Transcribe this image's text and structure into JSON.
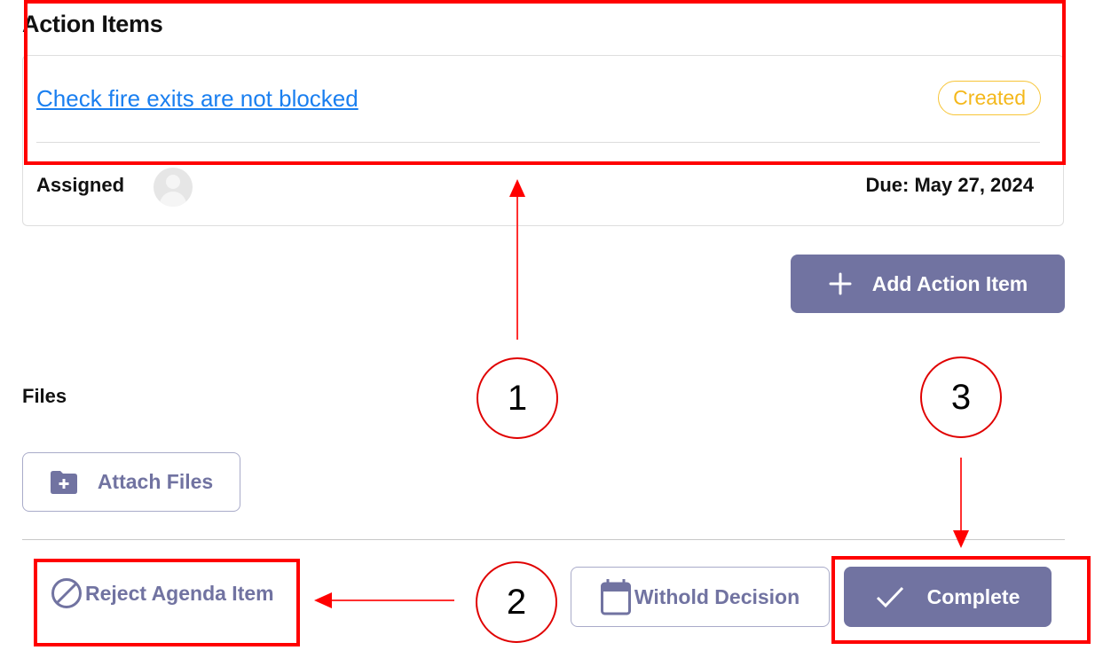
{
  "action_items": {
    "title": "Action Items",
    "items": [
      {
        "title": "Check fire exits are not blocked",
        "status": "Created",
        "assigned_label": "Assigned",
        "due": "Due: May 27, 2024"
      }
    ],
    "add_button_label": "Add Action Item"
  },
  "files": {
    "title": "Files",
    "attach_button_label": "Attach Files"
  },
  "footer": {
    "reject_label": "Reject Agenda Item",
    "withhold_label": "Withold Decision",
    "complete_label": "Complete"
  },
  "annotations": {
    "markers": [
      "1",
      "2",
      "3"
    ]
  },
  "colors": {
    "accent": "#7173a1",
    "link": "#1a7ff0",
    "status_created": "#f4b81b",
    "annotation": "#ff0000"
  }
}
